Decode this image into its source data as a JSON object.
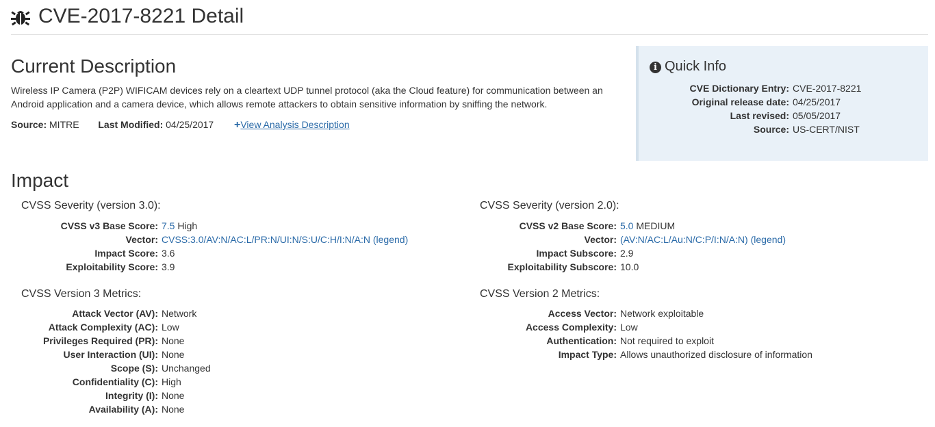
{
  "header": {
    "title": "CVE-2017-8221 Detail",
    "icon": "bug-icon"
  },
  "description": {
    "heading": "Current Description",
    "text": "Wireless IP Camera (P2P) WIFICAM devices rely on a cleartext UDP tunnel protocol (aka the Cloud feature) for communication between an Android application and a camera device, which allows remote attackers to obtain sensitive information by sniffing the network.",
    "source_label": "Source:",
    "source_value": "MITRE",
    "modified_label": "Last Modified:",
    "modified_value": "04/25/2017",
    "analysis_link": "View Analysis Description"
  },
  "quick_info": {
    "heading": "Quick Info",
    "rows": [
      {
        "label": "CVE Dictionary Entry:",
        "value": "CVE-2017-8221",
        "link": true
      },
      {
        "label": "Original release date:",
        "value": "04/25/2017"
      },
      {
        "label": "Last revised:",
        "value": "05/05/2017"
      },
      {
        "label": "Source:",
        "value": "US-CERT/NIST"
      }
    ]
  },
  "impact": {
    "heading": "Impact",
    "v3": {
      "severity_heading": "CVSS Severity (version 3.0):",
      "base_score_label": "CVSS v3 Base Score:",
      "base_score": "7.5",
      "base_severity": "High",
      "vector_label": "Vector:",
      "vector": "CVSS:3.0/AV:N/AC:L/PR:N/UI:N/S:U/C:H/I:N/A:N",
      "legend_open": "(",
      "legend": "legend",
      "legend_close": ")",
      "impact_label": "Impact Score:",
      "impact": "3.6",
      "exploit_label": "Exploitability Score:",
      "exploit": "3.9",
      "metrics_heading": "CVSS Version 3 Metrics:",
      "metrics": [
        {
          "label": "Attack Vector (AV):",
          "value": "Network"
        },
        {
          "label": "Attack Complexity (AC):",
          "value": "Low"
        },
        {
          "label": "Privileges Required (PR):",
          "value": "None"
        },
        {
          "label": "User Interaction (UI):",
          "value": "None"
        },
        {
          "label": "Scope (S):",
          "value": "Unchanged"
        },
        {
          "label": "Confidentiality (C):",
          "value": "High"
        },
        {
          "label": "Integrity (I):",
          "value": "None"
        },
        {
          "label": "Availability (A):",
          "value": "None"
        }
      ]
    },
    "v2": {
      "severity_heading": "CVSS Severity (version 2.0):",
      "base_score_label": "CVSS v2 Base Score:",
      "base_score": "5.0",
      "base_severity": "MEDIUM",
      "vector_label": "Vector:",
      "vector": "(AV:N/AC:L/Au:N/C:P/I:N/A:N)",
      "legend_open": "(",
      "legend": "legend",
      "legend_close": ")",
      "impact_label": "Impact Subscore:",
      "impact": "2.9",
      "exploit_label": "Exploitability Subscore:",
      "exploit": "10.0",
      "metrics_heading": "CVSS Version 2 Metrics:",
      "metrics": [
        {
          "label": "Access Vector:",
          "value": "Network exploitable"
        },
        {
          "label": "Access Complexity:",
          "value": "Low"
        },
        {
          "label": "Authentication:",
          "value": "Not required to exploit"
        },
        {
          "label": "Impact Type:",
          "value": "Allows unauthorized disclosure of information"
        }
      ]
    }
  },
  "colors": {
    "link": "#2a6aa8",
    "panel_bg": "#e9f1f8",
    "text": "#333333"
  }
}
